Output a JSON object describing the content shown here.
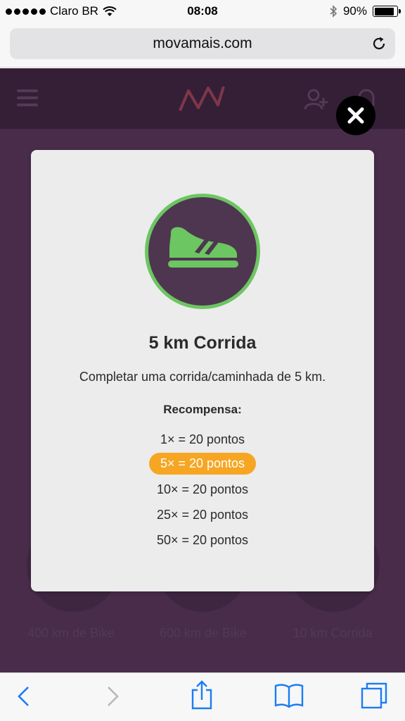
{
  "status_bar": {
    "carrier": "Claro BR",
    "time": "08:08",
    "battery": "90%",
    "battery_level": 0.9
  },
  "browser": {
    "url": "movamais.com"
  },
  "background_page": {
    "badge_labels": [
      "400 km de Bike",
      "600 km de Bike",
      "10 km Corrida"
    ]
  },
  "modal": {
    "title": "5 km Corrida",
    "description": "Completar uma corrida/caminhada de 5 km.",
    "reward_heading": "Recompensa:",
    "rewards": [
      {
        "label": "1× = 20 pontos",
        "active": false
      },
      {
        "label": "5× = 20 pontos",
        "active": true
      },
      {
        "label": "10× = 20 pontos",
        "active": false
      },
      {
        "label": "25× = 20 pontos",
        "active": false
      },
      {
        "label": "50× = 20 pontos",
        "active": false
      }
    ],
    "badge_icon": "running-shoe-icon"
  },
  "colors": {
    "accent_green": "#6cc661",
    "highlight_orange": "#f6a623",
    "site_purple": "#5a3a5c",
    "header_purple": "#3b2540"
  }
}
